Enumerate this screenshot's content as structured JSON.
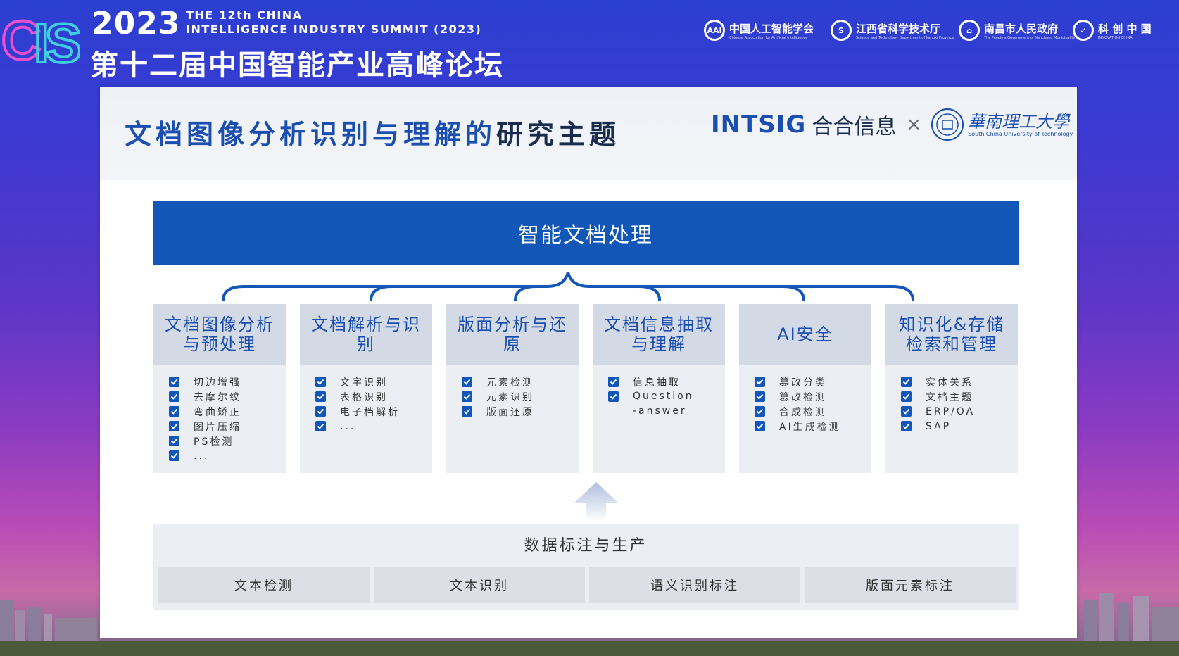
{
  "banner": {
    "logo_text": "CIIS",
    "year": "2023",
    "summit_en_line1": "THE 12th CHINA",
    "summit_en_line2": "INTELLIGENCE INDUSTRY SUMMIT (2023)",
    "summit_cn": "第十二届中国智能产业高峰论坛",
    "orgs": [
      {
        "mark": "AAI",
        "name": "中国人工智能学会",
        "sub": "Chinese Association for Artificial Intelligence"
      },
      {
        "mark": "S",
        "name": "江西省科学技术厅",
        "sub": "Science and Technology Department of Jiangxi Province"
      },
      {
        "mark": "⌂",
        "name": "南昌市人民政府",
        "sub": "The People's Government of Nanchang Municipality"
      },
      {
        "mark": "✓",
        "name": "科 创 中 国",
        "sub": "INNOVATION CHINA"
      }
    ]
  },
  "slide": {
    "title_blue": "文档图像分析识别与理解的",
    "title_dark": "研究主题",
    "brand": "INTSIG",
    "brand_cn": "合合信息",
    "times": "×",
    "partner_cn": "華南理工大學",
    "partner_en": "South China University of Technology",
    "main_box": "智能文档处理",
    "columns": [
      {
        "title": "文档图像分析与预处理",
        "items": [
          "切边增强",
          "去摩尔纹",
          "弯曲矫正",
          "图片压缩",
          "PS检测",
          "..."
        ]
      },
      {
        "title": "文档解析与识别",
        "items": [
          "文字识别",
          "表格识别",
          "电子档解析",
          "..."
        ]
      },
      {
        "title": "版面分析与还原",
        "items": [
          "元素检测",
          "元素识别",
          "版面还原"
        ]
      },
      {
        "title": "文档信息抽取与理解",
        "items": [
          "信息抽取",
          "Question\n-answer"
        ]
      },
      {
        "title": "AI安全",
        "items": [
          "篡改分类",
          "篡改检测",
          "合成检测",
          "AI生成检测"
        ]
      },
      {
        "title": "知识化&存储检索和管理",
        "items": [
          "实体关系",
          "文档主题",
          "ERP/OA",
          "SAP"
        ]
      }
    ],
    "data_panel": {
      "title": "数据标注与生产",
      "items": [
        "文本检测",
        "文本识别",
        "语义识别标注",
        "版面元素标注"
      ]
    }
  },
  "colors": {
    "accent": "#1257b8",
    "header_blue": "#1a4fb0",
    "column_head_bg": "#d3dae5",
    "column_bg": "#ebeef3"
  }
}
